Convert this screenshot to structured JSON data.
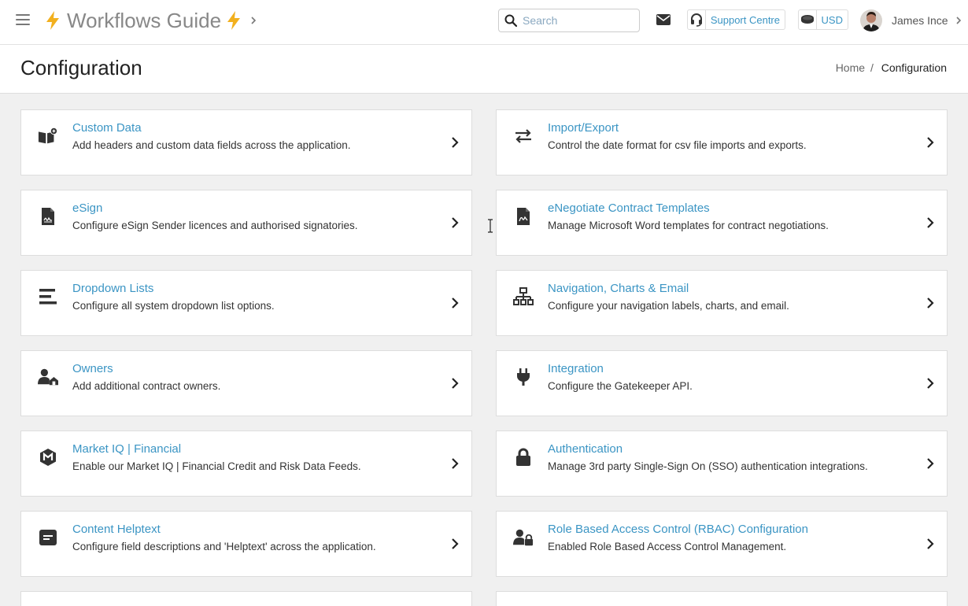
{
  "header": {
    "app_title": "Workflows Guide",
    "search_placeholder": "Search",
    "support_label": "Support Centre",
    "currency_label": "USD",
    "user_name": "James Ince"
  },
  "page": {
    "title": "Configuration",
    "breadcrumb": {
      "home": "Home",
      "separator": "/",
      "current": "Configuration"
    }
  },
  "cards": [
    {
      "icon": "book-plus-icon",
      "title": "Custom Data",
      "description": "Add headers and custom data fields across the application."
    },
    {
      "icon": "arrows-exchange-icon",
      "title": "Import/Export",
      "description": "Control the date format for csv file imports and exports."
    },
    {
      "icon": "signed-document-icon",
      "title": "eSign",
      "description": "Configure eSign Sender licences and authorised signatories."
    },
    {
      "icon": "contract-document-icon",
      "title": "eNegotiate Contract Templates",
      "description": "Manage Microsoft Word templates for contract negotiations."
    },
    {
      "icon": "list-lines-icon",
      "title": "Dropdown Lists",
      "description": "Configure all system dropdown list options."
    },
    {
      "icon": "network-icon",
      "title": "Navigation, Charts & Email",
      "description": "Configure your navigation labels, charts, and email."
    },
    {
      "icon": "user-home-icon",
      "title": "Owners",
      "description": "Add additional contract owners."
    },
    {
      "icon": "plug-icon",
      "title": "Integration",
      "description": "Configure the Gatekeeper API."
    },
    {
      "icon": "market-iq-icon",
      "title": "Market IQ | Financial",
      "description": "Enable our Market IQ | Financial Credit and Risk Data Feeds."
    },
    {
      "icon": "lock-icon",
      "title": "Authentication",
      "description": "Manage 3rd party Single-Sign On (SSO) authentication integrations."
    },
    {
      "icon": "message-square-icon",
      "title": "Content Helptext",
      "description": "Configure field descriptions and 'Helptext' across the application."
    },
    {
      "icon": "user-lock-icon",
      "title": "Role Based Access Control (RBAC) Configuration",
      "description": "Enabled Role Based Access Control Management."
    },
    {
      "icon": "",
      "title": "",
      "description": ""
    },
    {
      "icon": "",
      "title": "",
      "description": ""
    }
  ],
  "colors": {
    "accent": "#3b95c4",
    "bolt": "#f2b01e",
    "icon": "#333333"
  }
}
